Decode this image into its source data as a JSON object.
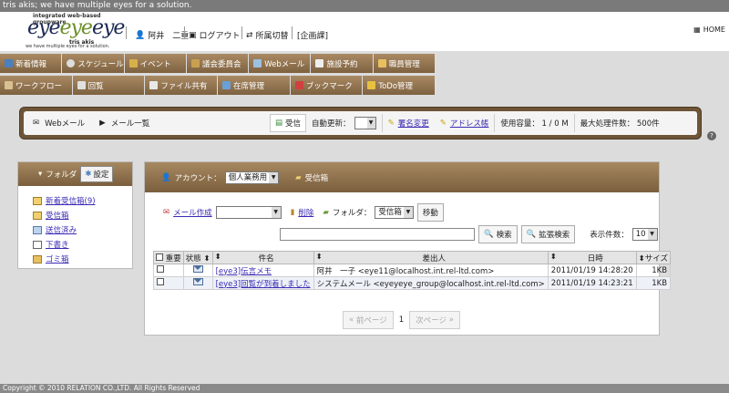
{
  "window": {
    "title": "tris akis; we have multiple eyes for a solution."
  },
  "logo": {
    "tagline": "integrated web-based groupware",
    "word_a": "eye",
    "word_b": "eye",
    "word_c": "eye",
    "company": "tris akis",
    "sub": "we have multiple eyes for a solution."
  },
  "header": {
    "user": "阿井　二重",
    "logout": "ログアウト",
    "switch_dept": "所属切替",
    "dept": "[企画課]",
    "home": "HOME"
  },
  "menu": {
    "row1": [
      "新着情報",
      "スケジュール",
      "イベント",
      "議会委員会",
      "Webメール",
      "施設予約",
      "職員管理"
    ],
    "row2": [
      "ワークフロー",
      "回覧",
      "ファイル共有",
      "在席管理",
      "ブックマーク",
      "ToDo管理"
    ]
  },
  "toolbar": {
    "breadcrumb_app": "Webメール",
    "breadcrumb_page": "メール一覧",
    "receive": "受信",
    "auto_update": "自動更新：",
    "signature": "署名変更",
    "address_book": "アドレス帳",
    "usage": "使用容量： 1 / 0 M",
    "max_items": "最大処理件数： 500件"
  },
  "folder_panel": {
    "folder_label": "フォルダ",
    "settings": "設定",
    "items": [
      "新着受信箱(9)",
      "受信箱",
      "送信済み",
      "下書き",
      "ゴミ箱"
    ]
  },
  "main": {
    "account_label": "アカウント：",
    "account_value": "個人業務用",
    "folder_name": "受信箱",
    "compose": "メール作成",
    "delete": "削除",
    "folder_label": "フォルダ：",
    "folder_value": "受信箱",
    "move": "移動",
    "search": "検索",
    "advanced_search": "拡張検索",
    "display_count_label": "表示件数：",
    "display_count": "10",
    "columns": [
      "重要",
      "状態",
      "件名",
      "差出人",
      "日時",
      "サイズ"
    ],
    "rows": [
      {
        "subject": "[eye3]伝言メモ",
        "from": "阿井　一子 <eye11@localhost.int.rel-ltd.com>",
        "date": "2011/01/19 14:28:20",
        "size": "1KB"
      },
      {
        "subject": "[eye3]回覧が到着しました",
        "from": "システムメール <eyeyeye_group@localhost.int.rel-ltd.com>",
        "date": "2011/01/19 14:23:21",
        "size": "1KB"
      }
    ],
    "prev": "前ページ",
    "page": "1",
    "next": "次ページ"
  },
  "footer": {
    "copyright": "Copyright © 2010 RELATION CO.,LTD. All Rights Reserved"
  }
}
